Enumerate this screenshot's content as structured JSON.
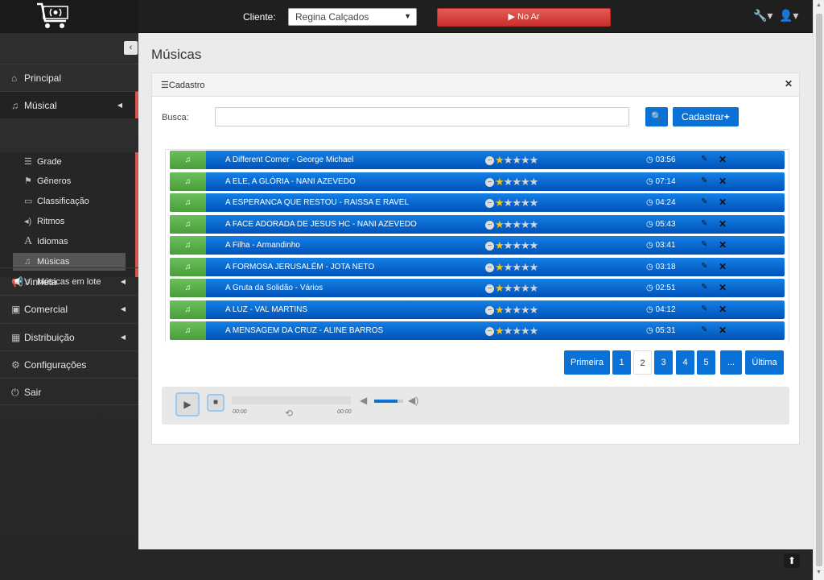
{
  "topbar": {
    "cliente_label": "Cliente:",
    "cliente_value": "Regina Calçados",
    "noar_label": "▶ No Ar",
    "icons": [
      "tools-icon",
      "user-icon"
    ]
  },
  "sidebar": {
    "items": [
      {
        "label": "Principal",
        "icon": "home-icon"
      },
      {
        "label": "Músical",
        "icon": "music-icon"
      },
      {
        "label": "Vinheta",
        "icon": "megaphone-icon"
      },
      {
        "label": "Comercial",
        "icon": "money-icon"
      },
      {
        "label": "Distribuição",
        "icon": "calendar-icon"
      },
      {
        "label": "Configurações",
        "icon": "cogs-icon"
      },
      {
        "label": "Sair",
        "icon": "power-icon"
      }
    ],
    "sub_items": [
      {
        "label": "Grade",
        "icon": "list-icon"
      },
      {
        "label": "Gêneros",
        "icon": "flag-icon"
      },
      {
        "label": "Classificação",
        "icon": "card-icon"
      },
      {
        "label": "Ritmos",
        "icon": "volume-icon"
      },
      {
        "label": "Idiomas",
        "icon": "font-icon"
      },
      {
        "label": "Músicas",
        "icon": "music-icon"
      },
      {
        "label": "Músicas em lote",
        "icon": "music-icon"
      }
    ]
  },
  "main": {
    "page_title": "Músicas",
    "panel_title": "Cadastro",
    "busca_label": "Busca:",
    "busca_value": "",
    "cadastrar_label": "Cadastrar",
    "songs": [
      {
        "name": "A Different Corner - George Michael",
        "rating": 1,
        "duration": "03:56"
      },
      {
        "name": "A ELE, A GLÓRIA - NANI AZEVEDO",
        "rating": 1,
        "duration": "07:14"
      },
      {
        "name": "A ESPERANCA QUE RESTOU - RAISSA E RAVEL",
        "rating": 1,
        "duration": "04:24"
      },
      {
        "name": "A FACE ADORADA DE JESUS HC - NANI AZEVEDO",
        "rating": 1,
        "duration": "05:43"
      },
      {
        "name": "A Filha - Armandinho",
        "rating": 1,
        "duration": "03:41"
      },
      {
        "name": "A FORMOSA JERUSALÉM - JOTA NETO",
        "rating": 1,
        "duration": "03:18"
      },
      {
        "name": "A Gruta da Solidão - Vários",
        "rating": 1,
        "duration": "02:51"
      },
      {
        "name": "A LUZ - VAL MARTINS",
        "rating": 1,
        "duration": "04:12"
      },
      {
        "name": "A MENSAGEM DA CRUZ - ALINE BARROS",
        "rating": 1,
        "duration": "05:31"
      }
    ],
    "pagination": {
      "first": "Primeira",
      "pages": [
        "1",
        "2",
        "3",
        "4",
        "5"
      ],
      "current": "2",
      "ellipsis": "...",
      "last": "Última"
    },
    "player": {
      "time_current": "00:00",
      "time_total": "00:00",
      "progress": 0,
      "volume": 0.8
    }
  },
  "colors": {
    "accent": "#0a72d6",
    "play_green": "#5cb85c",
    "danger": "#d9534f"
  }
}
